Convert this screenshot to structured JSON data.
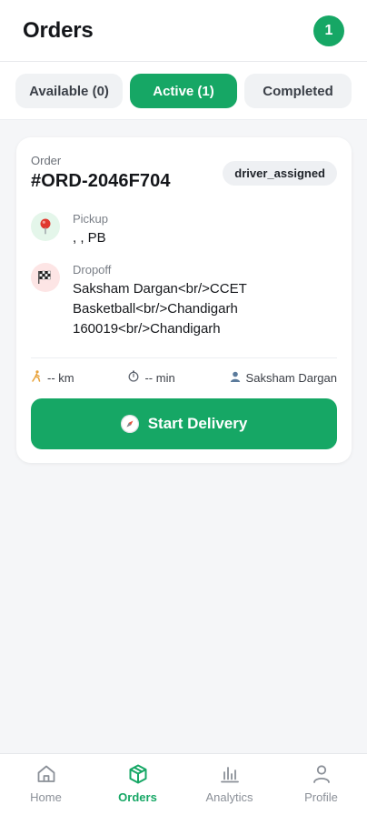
{
  "header": {
    "title": "Orders",
    "badge_count": "1"
  },
  "tabs": [
    {
      "label": "Available (0)",
      "active": false
    },
    {
      "label": "Active (1)",
      "active": true
    },
    {
      "label": "Completed",
      "active": false
    }
  ],
  "order": {
    "label": "Order",
    "id": "#ORD-2046F704",
    "status": "driver_assigned",
    "pickup": {
      "label": "Pickup",
      "value": ", , PB",
      "icon": "pin-icon"
    },
    "dropoff": {
      "label": "Dropoff",
      "value": "Saksham Dargan<br/>CCET Basketball<br/>Chandigarh 160019<br/>Chandigarh",
      "icon": "checkered-flag-icon"
    },
    "distance": "-- km",
    "duration": "-- min",
    "customer": "Saksham Dargan",
    "action_label": "Start Delivery"
  },
  "nav": [
    {
      "label": "Home",
      "icon": "home-icon",
      "active": false
    },
    {
      "label": "Orders",
      "icon": "package-icon",
      "active": true
    },
    {
      "label": "Analytics",
      "icon": "bar-chart-icon",
      "active": false
    },
    {
      "label": "Profile",
      "icon": "user-icon",
      "active": false
    }
  ],
  "colors": {
    "accent": "#16a765",
    "background": "#f5f6f8"
  }
}
